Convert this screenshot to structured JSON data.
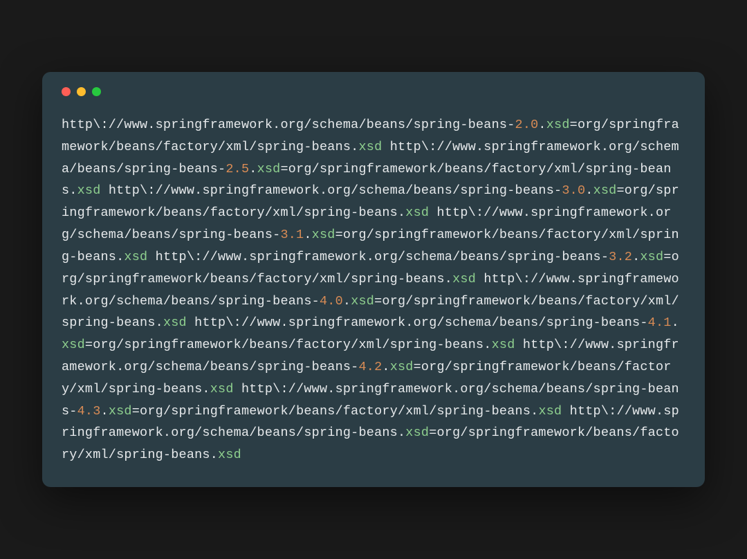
{
  "colors": {
    "window_bg": "#2b3d45",
    "dot_red": "#ff5f56",
    "dot_yellow": "#ffbd2e",
    "dot_green": "#27c93f",
    "text_default": "#e6e9eb",
    "text_number": "#d88b55",
    "text_ext": "#8ecf8e"
  },
  "entries": [
    {
      "prefix": "http\\://www.springframework.org/schema/beans/spring-beans-",
      "version": "2.0",
      "dot": ".",
      "ext1": "xsd",
      "eq": "=org/springframework/beans/factory/xml/spring-beans.",
      "ext2": "xsd"
    },
    {
      "prefix": "http\\://www.springframework.org/schema/beans/spring-beans-",
      "version": "2.5",
      "dot": ".",
      "ext1": "xsd",
      "eq": "=org/springframework/beans/factory/xml/spring-beans.",
      "ext2": "xsd"
    },
    {
      "prefix": "http\\://www.springframework.org/schema/beans/spring-beans-",
      "version": "3.0",
      "dot": ".",
      "ext1": "xsd",
      "eq": "=org/springframework/beans/factory/xml/spring-beans.",
      "ext2": "xsd"
    },
    {
      "prefix": "http\\://www.springframework.org/schema/beans/spring-beans-",
      "version": "3.1",
      "dot": ".",
      "ext1": "xsd",
      "eq": "=org/springframework/beans/factory/xml/spring-beans.",
      "ext2": "xsd"
    },
    {
      "prefix": "http\\://www.springframework.org/schema/beans/spring-beans-",
      "version": "3.2",
      "dot": ".",
      "ext1": "xsd",
      "eq": "=org/springframework/beans/factory/xml/spring-beans.",
      "ext2": "xsd"
    },
    {
      "prefix": "http\\://www.springframework.org/schema/beans/spring-beans-",
      "version": "4.0",
      "dot": ".",
      "ext1": "xsd",
      "eq": "=org/springframework/beans/factory/xml/spring-beans.",
      "ext2": "xsd"
    },
    {
      "prefix": "http\\://www.springframework.org/schema/beans/spring-beans-",
      "version": "4.1",
      "dot": ".",
      "ext1": "xsd",
      "eq": "=org/springframework/beans/factory/xml/spring-beans.",
      "ext2": "xsd"
    },
    {
      "prefix": "http\\://www.springframework.org/schema/beans/spring-beans-",
      "version": "4.2",
      "dot": ".",
      "ext1": "xsd",
      "eq": "=org/springframework/beans/factory/xml/spring-beans.",
      "ext2": "xsd"
    },
    {
      "prefix": "http\\://www.springframework.org/schema/beans/spring-beans-",
      "version": "4.3",
      "dot": ".",
      "ext1": "xsd",
      "eq": "=org/springframework/beans/factory/xml/spring-beans.",
      "ext2": "xsd"
    }
  ],
  "last_entry": {
    "prefix": "http\\://www.springframework.org/schema/beans/spring-beans.",
    "ext1": "xsd",
    "eq": "=org/springframework/beans/factory/xml/spring-beans.",
    "ext2": "xsd"
  }
}
